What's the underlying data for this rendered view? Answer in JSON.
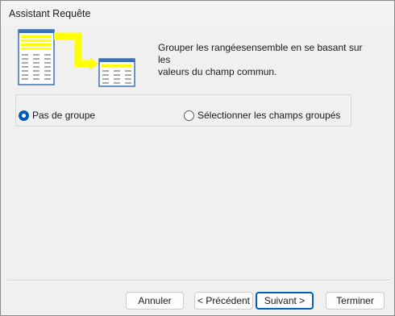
{
  "window": {
    "title": "Assistant Requête"
  },
  "description": {
    "line1": "Grouper les rangéesensemble en se basant sur les",
    "line2": "valeurs du champ commun."
  },
  "options": {
    "no_group": {
      "label": "Pas de groupe",
      "selected": true
    },
    "select_fields": {
      "label": "Sélectionner les champs groupés",
      "selected": false
    }
  },
  "buttons": {
    "cancel": "Annuler",
    "previous": "< Précédent",
    "next": "Suivant >",
    "finish": "Terminer"
  },
  "colors": {
    "accent": "#005fb8",
    "highlight": "#ffff00",
    "table_header": "#3b6fb6"
  }
}
